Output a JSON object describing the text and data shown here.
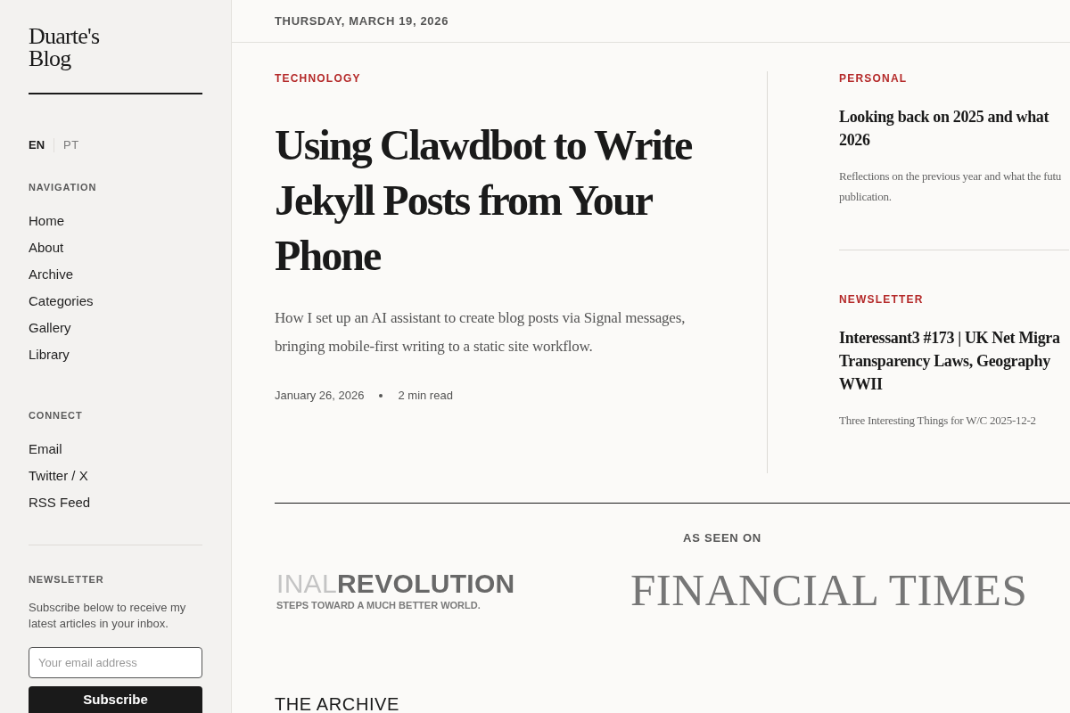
{
  "sidebar": {
    "logo": "Duarte's Blog",
    "languages": [
      {
        "label": "EN",
        "selected": true
      },
      {
        "label": "PT",
        "selected": false
      }
    ],
    "sections": [
      {
        "heading": "NAVIGATION",
        "links": [
          "Home",
          "About",
          "Archive",
          "Categories",
          "Gallery",
          "Library"
        ]
      },
      {
        "heading": "CONNECT",
        "links": [
          "Email",
          "Twitter / X",
          "RSS Feed"
        ]
      }
    ],
    "newsletter": {
      "heading": "NEWSLETTER",
      "text": "Subscribe below to receive my latest articles in your inbox.",
      "email_field": {
        "placeholder": "Your email address"
      },
      "button": "Subscribe"
    }
  },
  "header": {
    "date": "THURSDAY, MARCH 19, 2026"
  },
  "featured": {
    "category": "TECHNOLOGY",
    "title": "Using Clawdbot to Write Jekyll Posts from Your Phone",
    "excerpt": "How I set up an AI assistant to create blog posts via Signal messages, bringing mobile-first writing to a static site workflow.",
    "date": "January 26, 2026",
    "read_time": "2 min read"
  },
  "side_posts": [
    {
      "category": "PERSONAL",
      "title_lines": [
        "Looking back on 2025 and what",
        "2026"
      ],
      "excerpt_lines": [
        "Reflections on the previous year and what the futu",
        "publication."
      ]
    },
    {
      "category": "NEWSLETTER",
      "title_lines": [
        "Interessant3 #173 | UK Net Migra",
        "Transparency Laws, Geography",
        "WWII"
      ],
      "excerpt_lines": [
        "Three Interesting Things for W/C 2025-12-2"
      ]
    }
  ],
  "as_seen_on": {
    "heading": "AS SEEN ON",
    "logos": [
      {
        "kind": "two-tone",
        "wordmark": "INAL**REVOLUTION**",
        "tagline": "STEPS TOWARD A MUCH BETTER WORLD."
      },
      {
        "kind": "serif",
        "wordmark": "FINANCIAL TIMES"
      }
    ]
  },
  "archive": {
    "heading": "THE ARCHIVE"
  }
}
